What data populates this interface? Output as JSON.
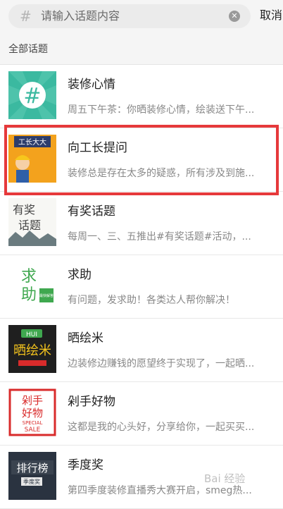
{
  "search": {
    "placeholder": "请输入话题内容",
    "cancel_label": "取消"
  },
  "section": {
    "label": "全部话题"
  },
  "topics": [
    {
      "title": "装修心情",
      "desc": "周五下午茶：你晒装修心情，绘装送下午...",
      "icon": "hash-icon"
    },
    {
      "title": "向工长提问",
      "desc": "装修总是存在太多的疑惑，所有涉及到施...",
      "icon": "foreman-icon"
    },
    {
      "title": "有奖话题",
      "desc": "每周一、三、五推出#有奖话题#活动，...",
      "icon": "prize-topic-icon"
    },
    {
      "title": "求助",
      "desc": "有问题，发求助！各类达人帮你解决！",
      "icon": "help-icon"
    },
    {
      "title": "晒绘米",
      "desc": "边装修边赚钱的愿望终于实现了，一起晒...",
      "icon": "huimi-icon"
    },
    {
      "title": "剁手好物",
      "desc": "这都是我的心头好，分享给你，一起买买...",
      "icon": "shopping-icon"
    },
    {
      "title": "季度奖",
      "desc": "第四季度装修直播秀大赛开启，smeg热...",
      "icon": "ranking-icon"
    }
  ],
  "thumb_text": {
    "foreman": "工长大大",
    "prize_a": "有奖",
    "prize_b": "话题",
    "help_a": "求",
    "help_b": "助",
    "help_badge": "最快解答",
    "huimi": "晒绘米",
    "hui": "HUI",
    "shop_a": "剁手",
    "shop_b": "好物",
    "shop_c": "SPECIAL",
    "shop_d": "SALE",
    "rank": "排行榜",
    "rank_sub": "季度奖"
  },
  "watermark": "Bai 经验",
  "colors": {
    "highlight": "#e6393b",
    "teal": "#3bb9a0",
    "orange": "#f3a21d",
    "green": "#3fa84f",
    "red": "#d92b2b"
  }
}
